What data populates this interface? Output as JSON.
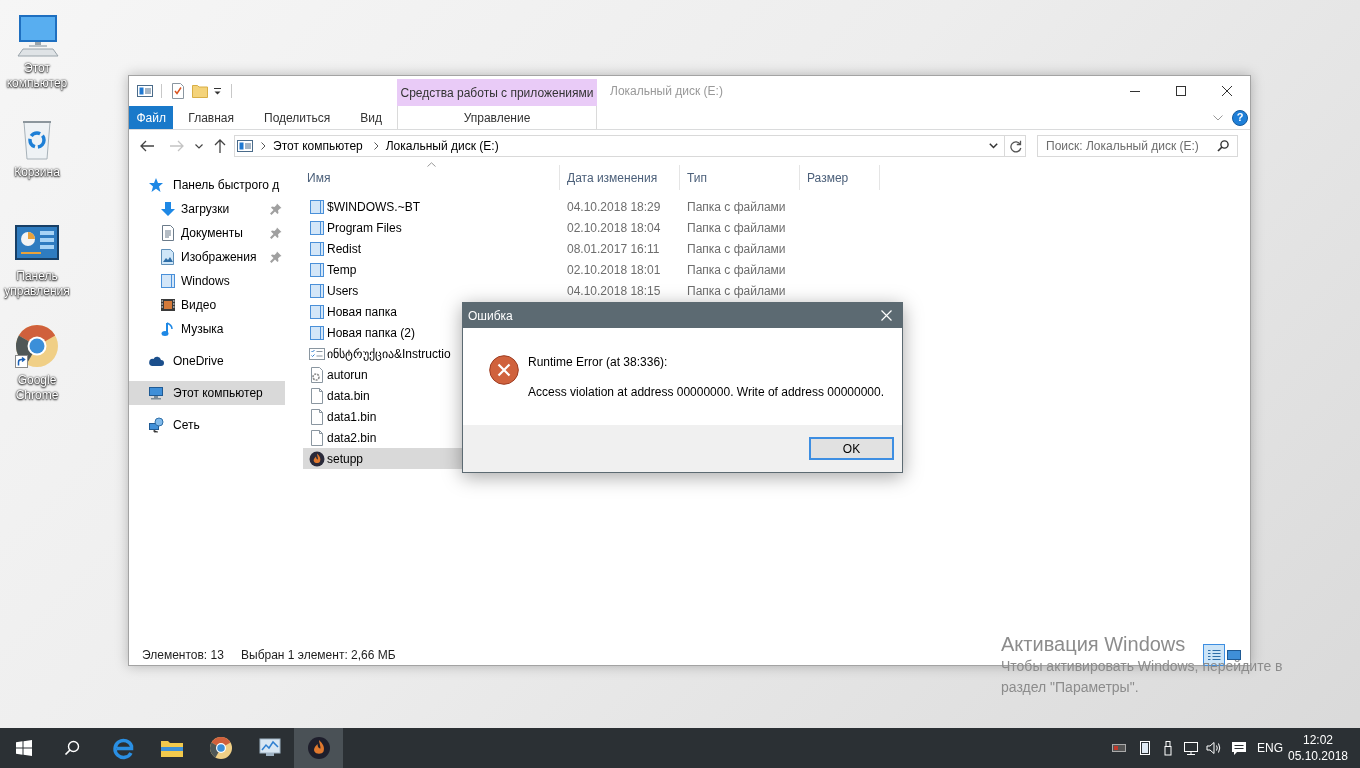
{
  "desktop_icons": [
    {
      "label": "Этот компьютер",
      "kind": "computer",
      "shortcut": false
    },
    {
      "label": "Корзина",
      "kind": "bin",
      "shortcut": false
    },
    {
      "label": "Панель управления",
      "kind": "panel",
      "shortcut": false
    },
    {
      "label": "Google Chrome",
      "kind": "browser",
      "shortcut": true
    }
  ],
  "explorer": {
    "title": "Локальный диск (E:)",
    "tool_group": "Средства работы с приложениями",
    "ribbon_tabs": [
      {
        "label": "Файл",
        "kind": "file",
        "selected": false
      },
      {
        "label": "Главная",
        "kind": "tab",
        "selected": false
      },
      {
        "label": "Поделиться",
        "kind": "tab",
        "selected": false
      },
      {
        "label": "Вид",
        "kind": "tab",
        "selected": false
      },
      {
        "label": "Управление",
        "kind": "context",
        "selected": false
      }
    ],
    "help": "?",
    "nav_buttons": [
      {
        "kind": "back",
        "disabled": false
      },
      {
        "kind": "forward",
        "disabled": true
      },
      {
        "kind": "recent",
        "disabled": false
      },
      {
        "kind": "up",
        "disabled": false
      }
    ],
    "address": {
      "crumbs": [
        "Этот компьютер",
        "Локальный диск (E:)"
      ]
    },
    "search": {
      "placeholder": "Поиск: Локальный диск (E:)"
    },
    "sidebar": {
      "items": [
        {
          "label": "Панель быстрого д",
          "kind": "quick",
          "selected": false,
          "children": [
            {
              "label": "Загрузки",
              "kind": "downloads",
              "selected": false,
              "pinned": true
            },
            {
              "label": "Документы",
              "kind": "documents",
              "selected": false,
              "pinned": true
            },
            {
              "label": "Изображения",
              "kind": "pictures",
              "selected": false,
              "pinned": true
            },
            {
              "label": "Windows",
              "kind": "folder",
              "selected": false,
              "pinned": false
            },
            {
              "label": "Видео",
              "kind": "video",
              "selected": false,
              "pinned": false
            },
            {
              "label": "Музыка",
              "kind": "music",
              "selected": false,
              "pinned": false
            }
          ]
        },
        {
          "label": "OneDrive",
          "kind": "cloud",
          "selected": false
        },
        {
          "label": "Этот компьютер",
          "kind": "pc",
          "selected": true
        },
        {
          "label": "Сеть",
          "kind": "network",
          "selected": false
        }
      ]
    },
    "table": {
      "columns": [
        {
          "label": "Имя",
          "sorted": true
        },
        {
          "label": "Дата изменения",
          "sorted": false
        },
        {
          "label": "Тип",
          "sorted": false
        },
        {
          "label": "Размер",
          "sorted": false
        }
      ],
      "rows": [
        {
          "name": "$WINDOWS.~BT",
          "kind": "folder",
          "modified": "04.10.2018 18:29",
          "type": "Папка с файлами",
          "selected": false
        },
        {
          "name": "Program Files",
          "kind": "folder",
          "modified": "02.10.2018 18:04",
          "type": "Папка с файлами",
          "selected": false
        },
        {
          "name": "Redist",
          "kind": "folder",
          "modified": "08.01.2017 16:11",
          "type": "Папка с файлами",
          "selected": false
        },
        {
          "name": "Temp",
          "kind": "folder",
          "modified": "02.10.2018 18:01",
          "type": "Папка с файлами",
          "selected": false
        },
        {
          "name": "Users",
          "kind": "folder",
          "modified": "04.10.2018 18:15",
          "type": "Папка с файлами",
          "selected": false
        },
        {
          "name": "Новая папка",
          "kind": "folder",
          "selected": false
        },
        {
          "name": "Новая папка (2)",
          "kind": "folder",
          "selected": false
        },
        {
          "name": "ინსტრუქცია&Instructio",
          "kind": "text",
          "selected": false
        },
        {
          "name": "autorun",
          "kind": "config",
          "selected": false
        },
        {
          "name": "data.bin",
          "kind": "file",
          "selected": false
        },
        {
          "name": "data1.bin",
          "kind": "file",
          "selected": false
        },
        {
          "name": "data2.bin",
          "kind": "file",
          "selected": false
        },
        {
          "name": "setupp",
          "kind": "app",
          "selected": true
        }
      ]
    },
    "status_bar": {
      "count": "Элементов: 13",
      "selection": "Выбран 1 элемент: 2,66 МБ",
      "views": [
        {
          "kind": "details",
          "selected": true
        },
        {
          "kind": "icons",
          "selected": false
        }
      ]
    }
  },
  "dialog": {
    "title": "Ошибка",
    "heading": "Runtime Error (at 38:336):",
    "message": "Access violation at address 00000000. Write of address 00000000.",
    "button": {
      "label": "OK",
      "default": true
    }
  },
  "activation_notice": {
    "title": "Активация Windows",
    "message": "Чтобы активировать Windows, перейдите в раздел \"Параметры\"."
  },
  "taskbar": {
    "apps": [
      {
        "kind": "edge",
        "active": false
      },
      {
        "kind": "explorer",
        "active": false
      },
      {
        "kind": "chrome",
        "active": false
      },
      {
        "kind": "monitor",
        "active": false
      },
      {
        "kind": "setup",
        "active": true
      }
    ],
    "tray": [
      {
        "kind": "card"
      },
      {
        "kind": "tablet"
      },
      {
        "kind": "usb"
      },
      {
        "kind": "network"
      },
      {
        "kind": "volume"
      },
      {
        "kind": "notifications"
      }
    ],
    "language": "ENG",
    "time": "12:02",
    "date": "05.10.2018"
  }
}
